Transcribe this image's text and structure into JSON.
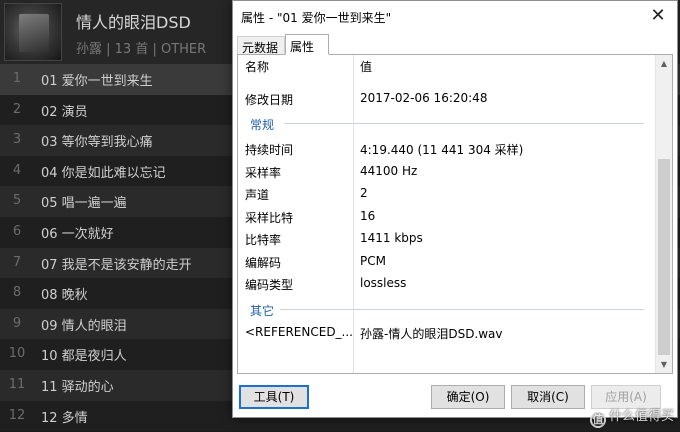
{
  "player": {
    "album_title": "情人的眼泪DSD",
    "album_subtitle": "孙露 | 13 首 | OTHER",
    "tracks": [
      {
        "num": "1",
        "title": "01 爱你一世到来生"
      },
      {
        "num": "2",
        "title": "02 演员"
      },
      {
        "num": "3",
        "title": "03 等你等到我心痛"
      },
      {
        "num": "4",
        "title": "04 你是如此难以忘记"
      },
      {
        "num": "5",
        "title": "05 唱一遍一遍"
      },
      {
        "num": "6",
        "title": "06 一次就好"
      },
      {
        "num": "7",
        "title": "07 我是不是该安静的走开"
      },
      {
        "num": "8",
        "title": "08 晚秋"
      },
      {
        "num": "9",
        "title": "09 情人的眼泪"
      },
      {
        "num": "10",
        "title": "10 都是夜归人"
      },
      {
        "num": "11",
        "title": "11 驿动的心"
      },
      {
        "num": "12",
        "title": "12 多情"
      }
    ]
  },
  "dialog": {
    "title": "属性 - \"01 爱你一世到来生\"",
    "close_glyph": "✕",
    "tabs": [
      "元数据",
      "属性"
    ],
    "header": {
      "name_col": "名称",
      "value_col": "值"
    },
    "rows": {
      "modified_name": "修改日期",
      "modified_value": "2017-02-06 16:20:48",
      "group_general": "常规",
      "duration_name": "持续时间",
      "duration_value": "4:19.440 (11 441 304 采样)",
      "samplerate_name": "采样率",
      "samplerate_value": "44100 Hz",
      "channels_name": "声道",
      "channels_value": "2",
      "bits_name": "采样比特",
      "bits_value": "16",
      "bitrate_name": "比特率",
      "bitrate_value": "1411 kbps",
      "codec_name": "编解码",
      "codec_value": "PCM",
      "encoding_name": "编码类型",
      "encoding_value": "lossless",
      "group_other": "其它",
      "ref_name": "<REFERENCED_...",
      "ref_value": "孙露-情人的眼泪DSD.wav"
    },
    "buttons": {
      "tools": "工具(T)",
      "ok": "确定(O)",
      "cancel": "取消(C)",
      "apply": "应用(A)"
    }
  },
  "watermark": {
    "icon_glyph": "值",
    "text": "什么值得买"
  },
  "colors": {
    "accent": "#1e6fcf",
    "group_label": "#1f5fa8"
  }
}
